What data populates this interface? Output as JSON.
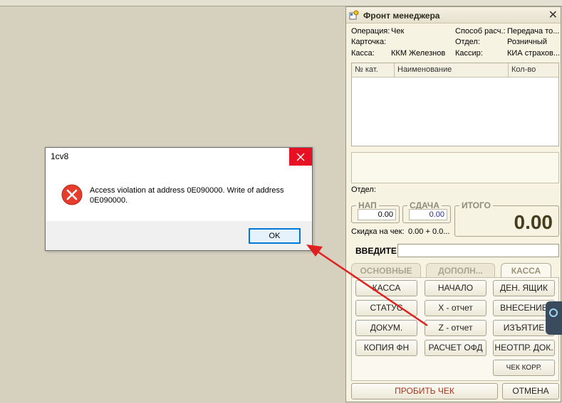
{
  "panel": {
    "title": "Фронт менеджера",
    "info": {
      "operation_label": "Операция:",
      "operation_value": "Чек",
      "card_label": "Карточка:",
      "cash_label": "Касса:",
      "cash_value": "ККМ Железнов",
      "payment_label": "Способ расч.:",
      "payment_value": "Передача то...",
      "dept_label": "Отдел:",
      "dept_value": "Розничный",
      "cashier_label": "Кассир:",
      "cashier_value": "КИА страхов..."
    },
    "grid": {
      "columns": [
        "№ кат.",
        "Наименование",
        "Кол-во"
      ]
    },
    "dept_bottom_label": "Отдел:",
    "totals": {
      "nap_label": "НАП",
      "nap_value": "0.00",
      "change_label": "СДАЧА",
      "change_value": "0.00",
      "total_label": "ИТОГО",
      "total_value": "0.00",
      "discount_label": "Скидка на чек:",
      "discount_value": "0.00 + 0.0..."
    },
    "enter_label": "ВВЕДИТЕ:",
    "tabs": [
      {
        "label": "ОСНОВНЫЕ"
      },
      {
        "label": "ДОПОЛН..."
      },
      {
        "label": "КАССА"
      }
    ],
    "buttons": {
      "kassa": "КАССА",
      "start": "НАЧАЛО",
      "cash_drawer": "ДЕН. ЯЩИК",
      "status": "СТАТУС",
      "x_report": "X - отчет",
      "deposit": "ВНЕСЕНИЕ",
      "docs": "ДОКУМ.",
      "z_report": "Z - отчет",
      "withdrawal": "ИЗЪЯТИЕ",
      "fn_copy": "КОПИЯ ФН",
      "ofd_calc": "РАСЧЕТ ОФД",
      "unsent_docs": "НЕОТПР. ДОК.",
      "correction_check": "ЧЕК КОРР.",
      "print_check": "ПРОБИТЬ ЧЕК",
      "cancel": "ОТМЕНА"
    }
  },
  "dialog": {
    "title": "1cv8",
    "message": "Access violation at address 0E090000. Write of address 0E090000.",
    "ok_label": "OK"
  },
  "colors": {
    "desktop": "#d6d1bf",
    "panel_bg": "#f6f3e3",
    "error_red": "#e81123",
    "ok_border": "#0078d7",
    "arrow": "#e02020",
    "total_text": "#453d1c"
  }
}
